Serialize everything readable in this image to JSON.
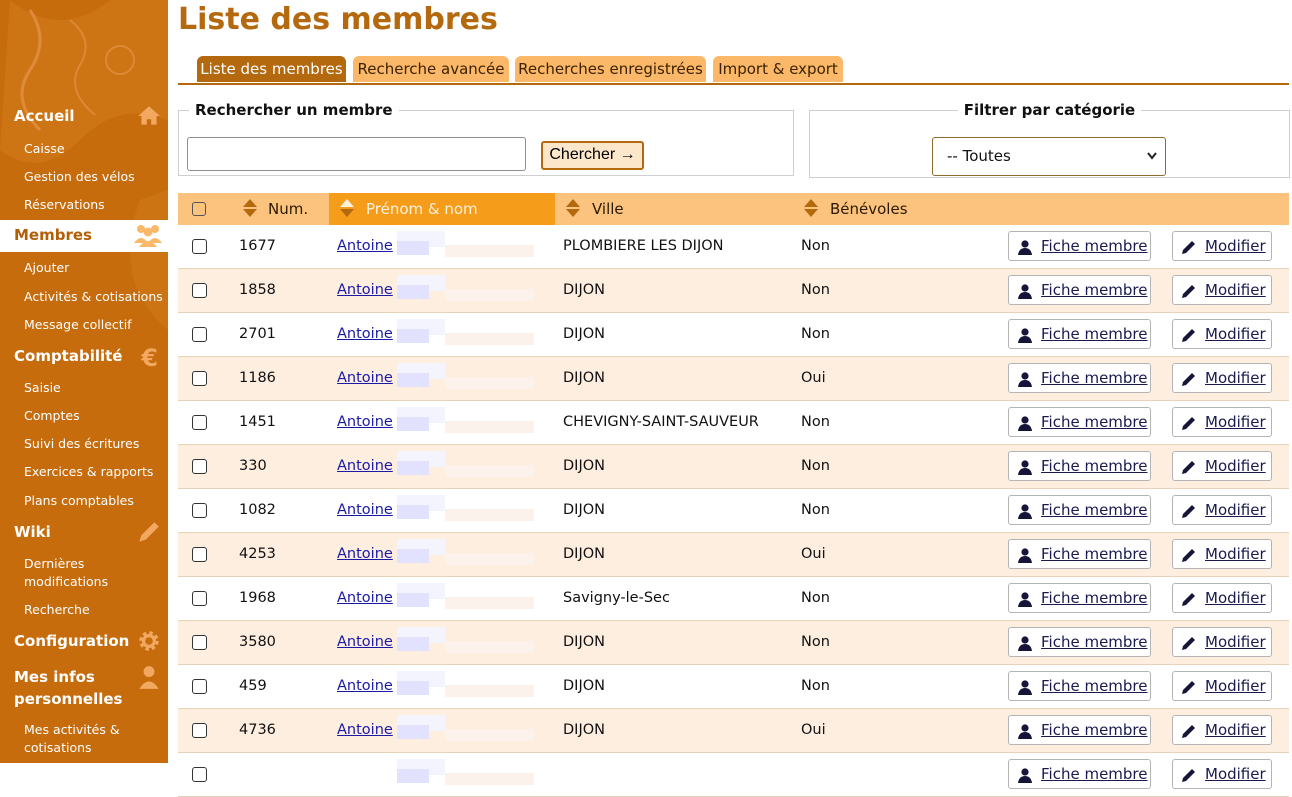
{
  "sidebar": {
    "sections": [
      {
        "label": "Accueil",
        "icon": "home-icon",
        "items": [
          "Caisse",
          "Gestion des vélos",
          "Réservations"
        ]
      },
      {
        "label": "Membres",
        "icon": "users-icon",
        "active": true,
        "items": [
          "Ajouter",
          "Activités & cotisations",
          "Message collectif"
        ]
      },
      {
        "label": "Comptabilité",
        "icon": "euro-icon",
        "items": [
          "Saisie",
          "Comptes",
          "Suivi des écritures",
          "Exercices & rapports",
          "Plans comptables"
        ]
      },
      {
        "label": "Wiki",
        "icon": "pencil-icon",
        "items": [
          "Dernières modifications",
          "Recherche"
        ]
      },
      {
        "label": "Configuration",
        "icon": "gear-icon",
        "items": []
      },
      {
        "label": "Mes infos personnelles",
        "icon": "user-icon",
        "items": [
          "Mes activités & cotisations"
        ]
      }
    ]
  },
  "page": {
    "title": "Liste des membres"
  },
  "tabs": [
    {
      "label": "Liste des membres",
      "active": true
    },
    {
      "label": "Recherche avancée"
    },
    {
      "label": "Recherches enregistrées"
    },
    {
      "label": "Import & export"
    }
  ],
  "search": {
    "legend": "Rechercher un membre",
    "value": "",
    "button_label": "Chercher →"
  },
  "filter": {
    "legend": "Filtrer par catégorie",
    "selected": "-- Toutes"
  },
  "table": {
    "columns": [
      "Num.",
      "Prénom & nom",
      "Ville",
      "Bénévoles"
    ],
    "sorted_column": "Prénom & nom",
    "action_labels": {
      "view": "Fiche membre",
      "edit": "Modifier"
    },
    "rows": [
      {
        "num": "1677",
        "name": "Antoine",
        "city": "PLOMBIERE LES DIJON",
        "volunteer": "Non"
      },
      {
        "num": "1858",
        "name": "Antoine",
        "city": "DIJON",
        "volunteer": "Non"
      },
      {
        "num": "2701",
        "name": "Antoine",
        "city": "DIJON",
        "volunteer": "Non"
      },
      {
        "num": "1186",
        "name": "Antoine",
        "city": "DIJON",
        "volunteer": "Oui"
      },
      {
        "num": "1451",
        "name": "Antoine",
        "city": "CHEVIGNY-SAINT-SAUVEUR",
        "volunteer": "Non"
      },
      {
        "num": "330",
        "name": "Antoine",
        "city": "DIJON",
        "volunteer": "Non"
      },
      {
        "num": "1082",
        "name": "Antoine",
        "city": "DIJON",
        "volunteer": "Non"
      },
      {
        "num": "4253",
        "name": "Antoine",
        "city": "DIJON",
        "volunteer": "Oui"
      },
      {
        "num": "1968",
        "name": "Antoine",
        "city": "Savigny-le-Sec",
        "volunteer": "Non"
      },
      {
        "num": "3580",
        "name": "Antoine",
        "city": "DIJON",
        "volunteer": "Non"
      },
      {
        "num": "459",
        "name": "Antoine",
        "city": "DIJON",
        "volunteer": "Non"
      },
      {
        "num": "4736",
        "name": "Antoine",
        "city": "DIJON",
        "volunteer": "Oui"
      },
      {
        "num": "",
        "name": "",
        "city": "",
        "volunteer": ""
      }
    ]
  },
  "colors": {
    "brand": "#b4690e",
    "sidebar": "#c66c0c",
    "header_row": "#fcc37e",
    "sorted_header": "#f59c1a",
    "even_row": "#fdeee0",
    "link": "#1a1aa6"
  }
}
